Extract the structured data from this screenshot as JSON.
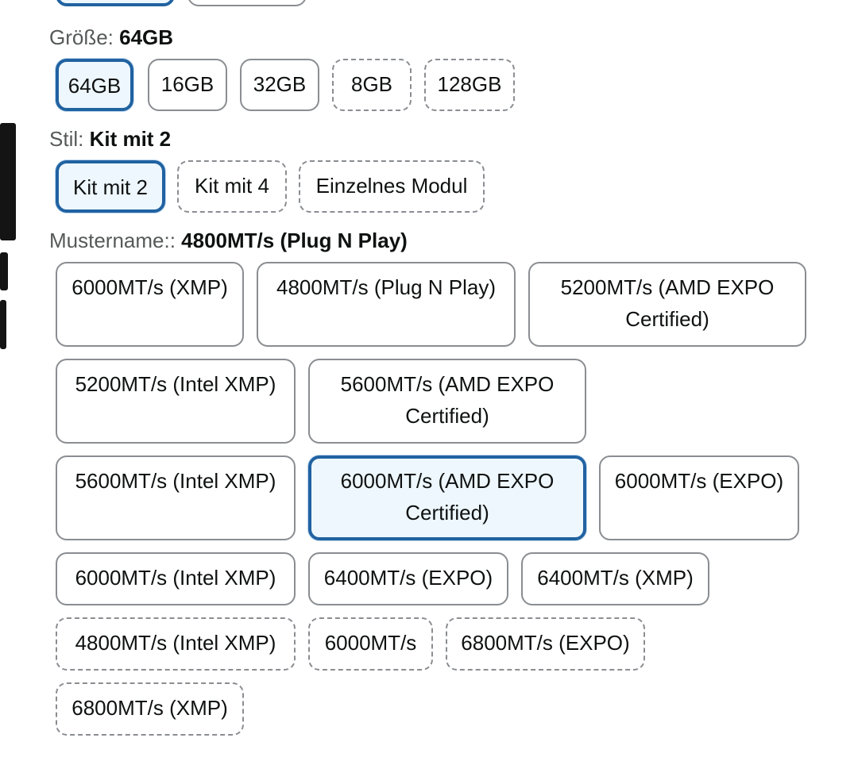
{
  "size": {
    "label": "Größe: ",
    "selected": "64GB",
    "options": [
      "64GB",
      "16GB",
      "32GB",
      "8GB",
      "128GB"
    ]
  },
  "style": {
    "label": "Stil: ",
    "selected": "Kit mit 2",
    "options": [
      "Kit mit 2",
      "Kit mit 4",
      "Einzelnes Modul"
    ]
  },
  "pattern": {
    "label": "Mustername:: ",
    "selected": "4800MT/s (Plug N Play)",
    "options": [
      "6000MT/s (XMP)",
      "4800MT/s (Plug N Play)",
      "5200MT/s (AMD EXPO Certified)",
      "5200MT/s (Intel XMP)",
      "5600MT/s (AMD EXPO Certified)",
      "5600MT/s (Intel XMP)",
      "6000MT/s (AMD EXPO Certified)",
      "6000MT/s (EXPO)",
      "6000MT/s (Intel XMP)",
      "6400MT/s (EXPO)",
      "6400MT/s (XMP)",
      "4800MT/s (Intel XMP)",
      "6000MT/s",
      "6800MT/s (EXPO)",
      "6800MT/s (XMP)"
    ]
  },
  "colors": {
    "selected_border": "#2162a1",
    "selected_bg": "#edf7fd",
    "border": "#8a8d91"
  }
}
